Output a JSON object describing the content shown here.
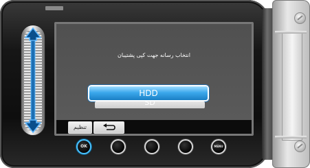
{
  "screen": {
    "prompt": "انتخاب رسانه جهت کپی پشتیبان",
    "options": [
      {
        "label": "HDD",
        "selected": true
      },
      {
        "label": "SD",
        "selected": false
      }
    ]
  },
  "soft_keys": {
    "settings_label": "تنظیم",
    "back_icon": "return-arrow-icon"
  },
  "hardware_buttons": {
    "ok_label": "OK",
    "menu_label": "MENU"
  },
  "colors": {
    "selection_blue": "#3ba8ec",
    "ok_ring": "#4cc3ff"
  }
}
